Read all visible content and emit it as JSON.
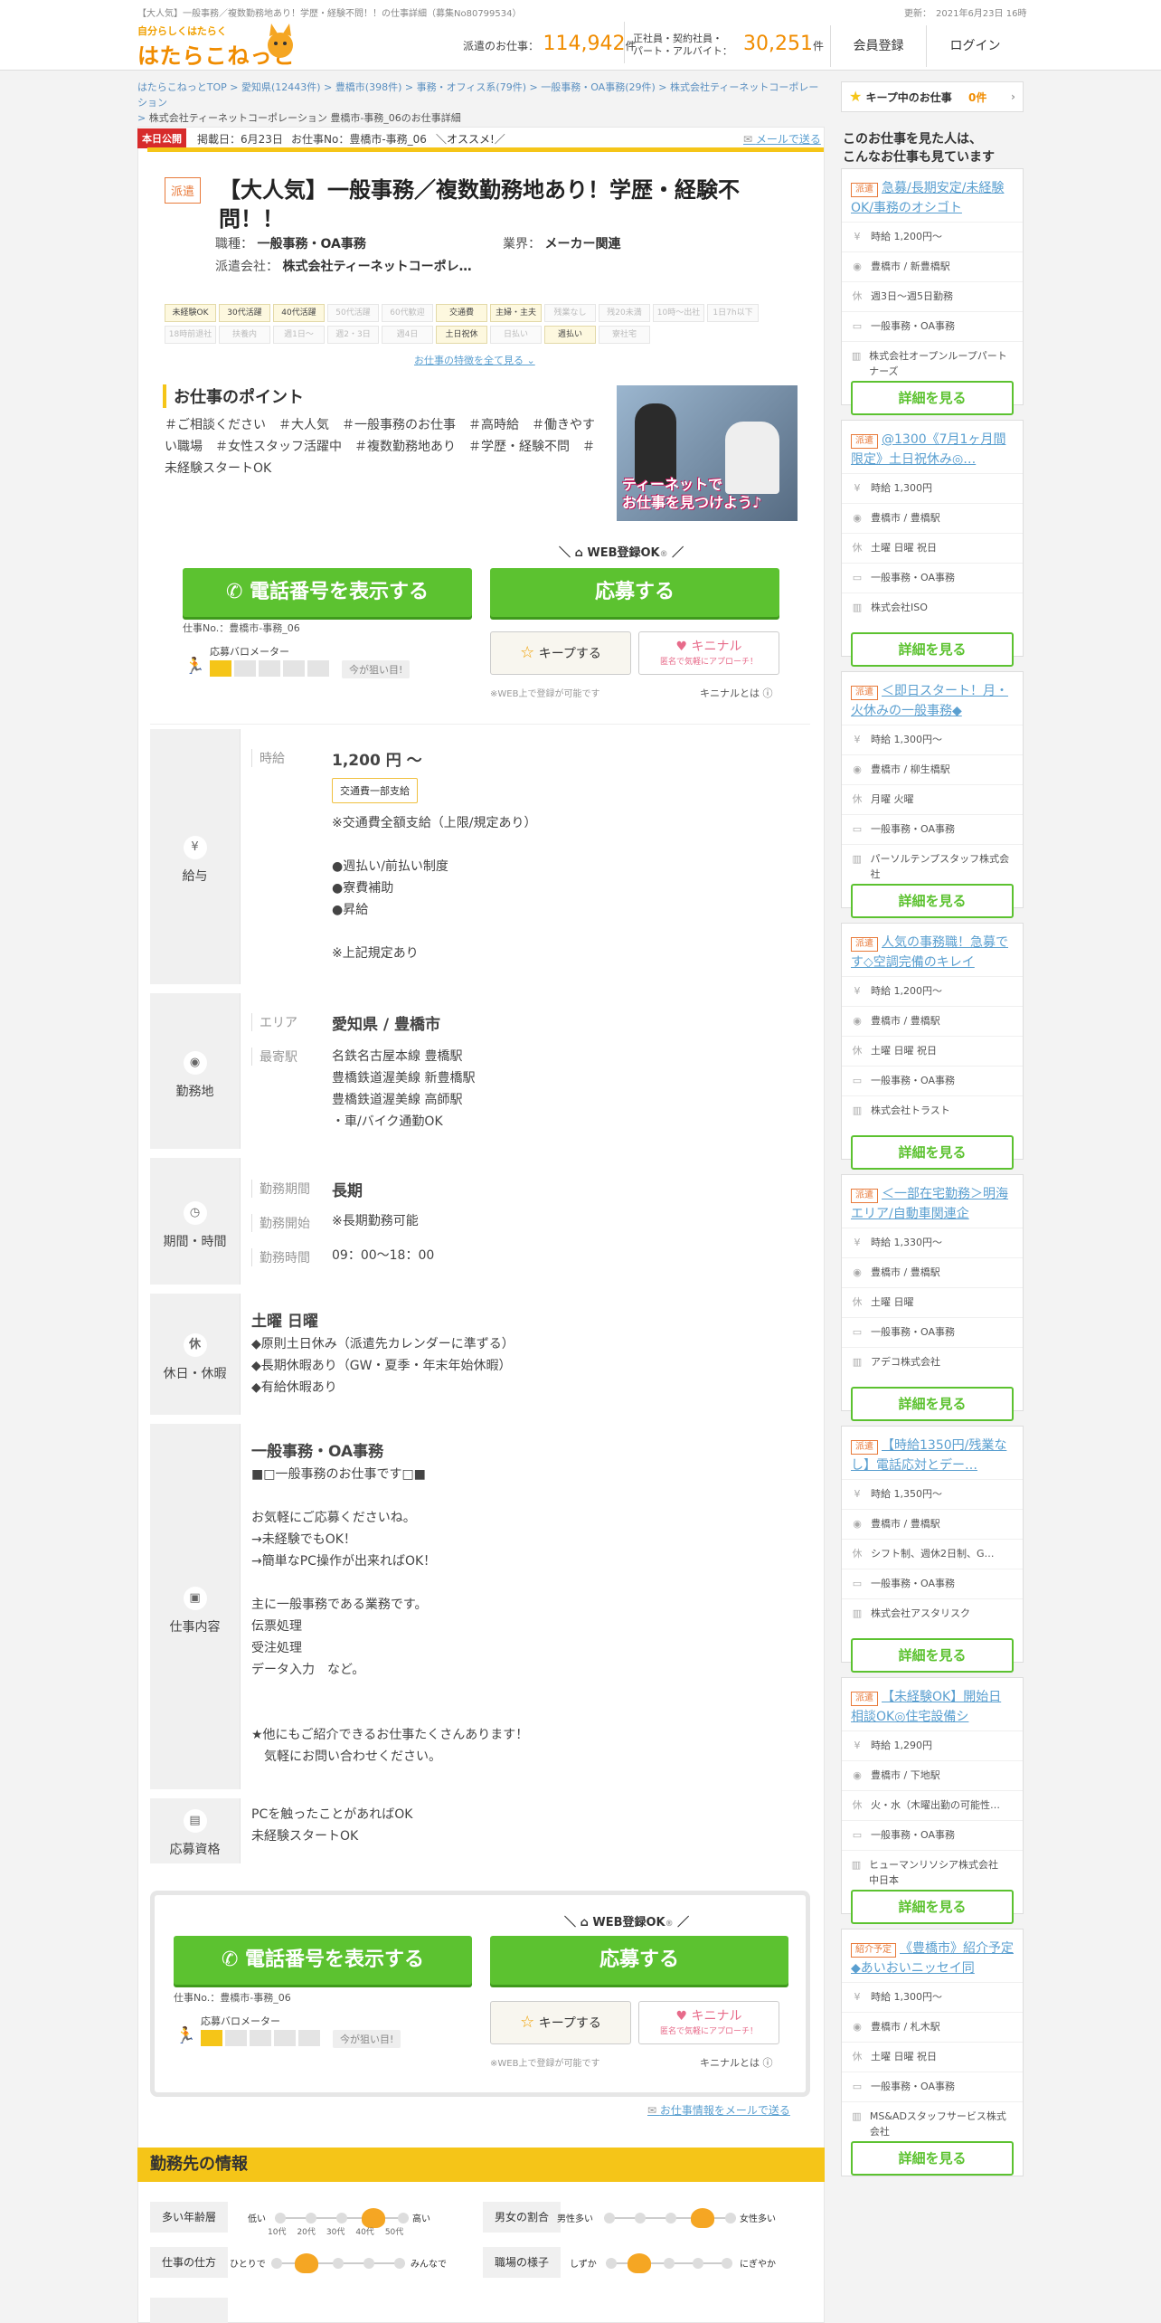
{
  "header": {
    "top_desc": "【大人気】一般事務／複数勤務地あり！学歴・経験不問！！の仕事詳細（募集No80799534）",
    "logo_sub": "自分らしくはたらく",
    "logo_main": "はたらこねっと",
    "updated": "更新：　2021年6月23日 16時",
    "haken_label": "派遣のお仕事：",
    "haken_count": "114,942",
    "haken_unit": "件",
    "seishain_label1": "正社員・契約社員・",
    "seishain_label2": "パート・アルバイト：",
    "seishain_count": "30,251",
    "seishain_unit": "件",
    "member_btn": "会員登録",
    "login_btn": "ログイン"
  },
  "breadcrumb": {
    "links": [
      "はたらこねっとTOP",
      "愛知県(12443件)",
      "豊橋市(398件)",
      "事務・オフィス系(79件)",
      "一般事務・OA事務(29件)",
      "株式会社ティーネットコーポレーション"
    ],
    "sep": ">",
    "line2": "株式会社ティーネットコーポレーション 豊橋市-事務_06のお仕事詳細"
  },
  "job": {
    "badge": "本日公開",
    "posted": "掲載日：6月23日",
    "jobno_line": "お仕事No：豊橋市-事務_06",
    "osusume": "＼オススメ!／",
    "mail_send": "メールで送る",
    "type_badge": "派遣",
    "title_l1": "【大人気】一般事務／複数勤務地あり！学歴・経験不",
    "title_l2": "問！！",
    "shokushu_l": "職種：",
    "shokushu_v": "一般事務・OA事務",
    "gyokai_l": "業界：",
    "gyokai_v": "メーカー関連",
    "company_l": "派遣会社：",
    "company_v": "株式会社ティーネットコーポレ…",
    "tags": [
      {
        "t": "未経験OK",
        "on": true
      },
      {
        "t": "30代活躍",
        "on": true
      },
      {
        "t": "40代活躍",
        "on": true
      },
      {
        "t": "50代活躍",
        "on": false
      },
      {
        "t": "60代歓迎",
        "on": false
      },
      {
        "t": "交通費",
        "on": true
      },
      {
        "t": "主婦・主夫",
        "on": true
      },
      {
        "t": "残業なし",
        "on": false
      },
      {
        "t": "残20未満",
        "on": false
      },
      {
        "t": "10時～出社",
        "on": false
      },
      {
        "t": "1日7h以下",
        "on": false
      },
      {
        "t": "18時前退社",
        "on": false
      },
      {
        "t": "扶養内",
        "on": false
      },
      {
        "t": "週1日～",
        "on": false
      },
      {
        "t": "週2・3日",
        "on": false
      },
      {
        "t": "週4日",
        "on": false
      },
      {
        "t": "土日祝休",
        "on": true
      },
      {
        "t": "日払い",
        "on": false
      },
      {
        "t": "週払い",
        "on": true
      },
      {
        "t": "寮社宅",
        "on": false
      }
    ],
    "tags_more": "お仕事の特徴を全て見る",
    "points_h": "お仕事のポイント",
    "points_text": "＃ご相談ください　＃大人気　＃一般事務のお仕事　＃高時給　＃働きやすい職場　＃女性スタッフ活躍中　＃複数勤務地あり　＃学歴・経験不問　＃未経験スタートOK",
    "photo_caption1": "ティーネットで",
    "photo_caption2": "お仕事を見つけよう♪"
  },
  "apply": {
    "web_ok": "WEB登録OK",
    "tel_btn": "電話番号を表示する",
    "apply_btn": "応募する",
    "jobno": "仕事No.：豊橋市-事務_06",
    "meter_label": "応募バロメーター",
    "meter_value": 1,
    "meter_max": 5,
    "meter_note": "今が狙い目!",
    "keep": "キープする",
    "kinichan": "キニナル",
    "kin_sub": "匿名で気軽にアプローチ！",
    "web_note": "※WEB上で登録が可能です",
    "kin_what": "キニナルとは"
  },
  "salary": {
    "head": "給与",
    "label": "時給",
    "amount": "1,200 円 ～",
    "transport_tag": "交通費一部支給",
    "notes": "※交通費全額支給（上限/規定あり）\n\n●週払い/前払い制度\n●寮費補助\n●昇給\n\n※上記規定あり"
  },
  "location": {
    "head": "勤務地",
    "area_l": "エリア",
    "area_v": "愛知県 / 豊橋市",
    "station_l": "最寄駅",
    "stations": "名鉄名古屋本線 豊橋駅\n豊橋鉄道渥美線 新豊橋駅\n豊橋鉄道渥美線 高師駅\n・車/バイク通勤OK"
  },
  "period": {
    "head": "期間・時間",
    "p_l": "勤務期間",
    "p_v": "長期",
    "s_l": "勤務開始",
    "s_v": "※長期勤務可能",
    "t_l": "勤務時間",
    "t_v": "09：00～18：00"
  },
  "holiday": {
    "head": "休日・休暇",
    "icon": "休",
    "title": "土曜 日曜",
    "text": "◆原則土日休み（派遣先カレンダーに準ずる）\n◆長期休暇あり（GW・夏季・年末年始休暇）\n◆有給休暇あり"
  },
  "work": {
    "head": "仕事内容",
    "title": "一般事務・OA事務",
    "text": "■□一般事務のお仕事です□■\n\nお気軽にご応募くださいね。\n→未経験でもOK！\n→簡単なPC操作が出来ればOK！\n\n主に一般事務である業務です。\n伝票処理\n受注処理\nデータ入力　など。\n\n\n★他にもご紹介できるお仕事たくさんあります！\n　気軽にお問い合わせください。"
  },
  "qualification": {
    "head": "応募資格",
    "text": "PCを触ったことがあればOK\n未経験スタートOK"
  },
  "footer_link": "お仕事情報をメールで送る",
  "workplace": {
    "head": "勤務先の情報",
    "age_l": "多い年齢層",
    "age_low": "低い",
    "age_high": "高い",
    "ages": [
      "10代",
      "20代",
      "30代",
      "40代",
      "50代"
    ],
    "gender_l": "男女の割合",
    "gender_m": "男性多い",
    "gender_f": "女性多い",
    "style_l": "仕事の仕方",
    "style_a": "ひとりで",
    "style_b": "みんなで",
    "mood_l": "職場の様子",
    "mood_a": "しずか",
    "mood_b": "にぎやか"
  },
  "sidebar": {
    "keep_label": "キープ中のお仕事",
    "keep_count": "0件",
    "heading1": "このお仕事を見た人は、",
    "heading2": "こんなお仕事も見ています",
    "cards": [
      {
        "tag": "派遣",
        "title": "急募/長期安定/未経験OK/事務のオシゴト",
        "wage": "時給 1,200円～",
        "station": "豊橋市 / 新豊橋駅",
        "hol": "週3日～週5日勤務",
        "job": "一般事務・OA事務",
        "co": "株式会社オープンループパートナーズ"
      },
      {
        "tag": "派遣",
        "title": "@1300《7月1ヶ月間限定》土日祝休み◎…",
        "wage": "時給 1,300円",
        "station": "豊橋市 / 豊橋駅",
        "hol": "土曜 日曜 祝日",
        "job": "一般事務・OA事務",
        "co": "株式会社ISO"
      },
      {
        "tag": "派遣",
        "title": "＜即日スタート！月・火休みの一般事務◆",
        "wage": "時給 1,300円～",
        "station": "豊橋市 / 柳生橋駅",
        "hol": "月曜 火曜",
        "job": "一般事務・OA事務",
        "co": "パーソルテンプスタッフ株式会社"
      },
      {
        "tag": "派遣",
        "title": "人気の事務職！急募です◇空調完備のキレイ",
        "wage": "時給 1,200円～",
        "station": "豊橋市 / 豊橋駅",
        "hol": "土曜 日曜 祝日",
        "job": "一般事務・OA事務",
        "co": "株式会社トラスト"
      },
      {
        "tag": "派遣",
        "title": "＜一部在宅勤務＞明海エリア/自動車関連企",
        "wage": "時給 1,330円～",
        "station": "豊橋市 / 豊橋駅",
        "hol": "土曜 日曜",
        "job": "一般事務・OA事務",
        "co": "アデコ株式会社"
      },
      {
        "tag": "派遣",
        "title": "【時給1350円/残業なし】電話応対とデー…",
        "wage": "時給 1,350円～",
        "station": "豊橋市 / 豊橋駅",
        "hol": "シフト制、週休2日制、G…",
        "job": "一般事務・OA事務",
        "co": "株式会社アスタリスク"
      },
      {
        "tag": "派遣",
        "title": "【未経験OK】開始日相談OK◎住宅設備シ",
        "wage": "時給 1,290円",
        "station": "豊橋市 / 下地駅",
        "hol": "火・水（木曜出勤の可能性…",
        "job": "一般事務・OA事務",
        "co": "ヒューマンリソシア株式会社　中日本"
      },
      {
        "tag": "紹介予定",
        "title": "《豊橋市》紹介予定◆あいおいニッセイ同",
        "wage": "時給 1,300円～",
        "station": "豊橋市 / 札木駅",
        "hol": "土曜 日曜 祝日",
        "job": "一般事務・OA事務",
        "co": "MS&ADスタッフサービス株式会社"
      }
    ],
    "detail_btn": "詳細を見る"
  }
}
